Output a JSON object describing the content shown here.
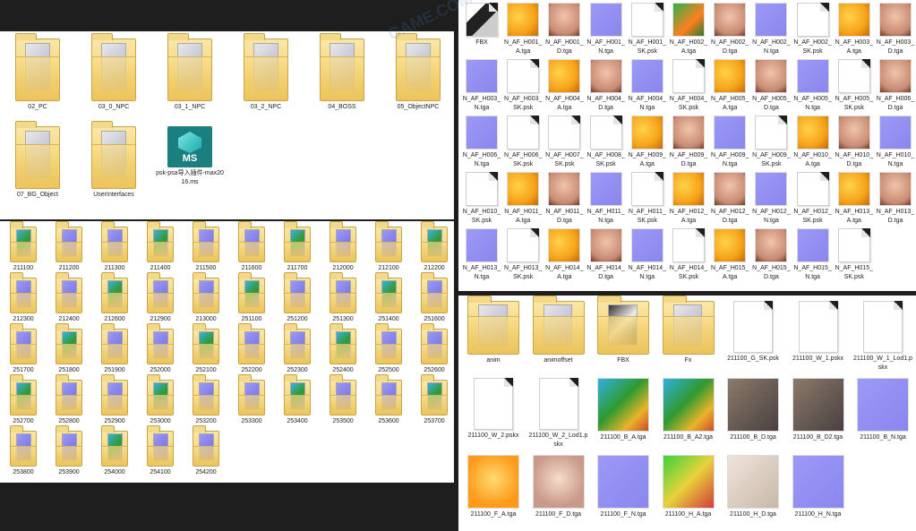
{
  "panels": {
    "top_left": {
      "items": [
        {
          "type": "folder",
          "label": "02_PC"
        },
        {
          "type": "folder",
          "label": "03_0_NPC"
        },
        {
          "type": "folder",
          "label": "03_1_NPC"
        },
        {
          "type": "folder",
          "label": "03_2_NPC"
        },
        {
          "type": "folder",
          "label": "04_BOSS"
        },
        {
          "type": "folder",
          "label": "05_ObjectNPC"
        },
        {
          "type": "folder",
          "label": "07_BG_Object"
        },
        {
          "type": "folder",
          "label": "UserInterfaces"
        },
        {
          "type": "ms",
          "label": "psk-psa导入插件-max2016.ms",
          "icon_text": "MS"
        }
      ]
    },
    "left_bottom": {
      "items": [
        "211100",
        "211200",
        "211300",
        "211400",
        "211500",
        "211600",
        "211700",
        "212000",
        "212100",
        "212200",
        "212300",
        "212400",
        "212600",
        "212900",
        "213000",
        "251100",
        "251200",
        "251300",
        "251400",
        "251600",
        "251700",
        "251800",
        "251900",
        "252000",
        "252100",
        "252200",
        "252300",
        "252400",
        "252500",
        "252600",
        "252700",
        "252800",
        "252900",
        "253000",
        "253200",
        "253300",
        "253400",
        "253500",
        "253600",
        "253700",
        "253800",
        "253900",
        "254000",
        "254100",
        "254200"
      ]
    },
    "top_right": {
      "items": [
        {
          "type": "fbx",
          "label": "FBX"
        },
        {
          "type": "orange",
          "label": "N_AF_H001_A.tga"
        },
        {
          "type": "skin",
          "label": "N_AF_H001_D.tga"
        },
        {
          "type": "normal",
          "label": "N_AF_H001_N.tga"
        },
        {
          "type": "file",
          "label": "N_AF_H001_SK.psk"
        },
        {
          "type": "green",
          "label": "N_AF_H002_A.tga"
        },
        {
          "type": "skin",
          "label": "N_AF_H002_D.tga"
        },
        {
          "type": "normal",
          "label": "N_AF_H002_N.tga"
        },
        {
          "type": "file",
          "label": "N_AF_H002_SK.psk"
        },
        {
          "type": "orange",
          "label": "N_AF_H003_A.tga"
        },
        {
          "type": "skin",
          "label": "N_AF_H003_D.tga"
        },
        {
          "type": "normal",
          "label": "N_AF_H003_N.tga"
        },
        {
          "type": "file",
          "label": "N_AF_H003_SK.psk"
        },
        {
          "type": "orange",
          "label": "N_AF_H004_A.tga"
        },
        {
          "type": "skin",
          "label": "N_AF_H004_D.tga"
        },
        {
          "type": "normal",
          "label": "N_AF_H004_N.tga"
        },
        {
          "type": "file",
          "label": "N_AF_H004_SK.psk"
        },
        {
          "type": "orange",
          "label": "N_AF_H005_A.tga"
        },
        {
          "type": "skin",
          "label": "N_AF_H005_D.tga"
        },
        {
          "type": "normal",
          "label": "N_AF_H005_N.tga"
        },
        {
          "type": "file",
          "label": "N_AF_H005_SK.psk"
        },
        {
          "type": "skin",
          "label": "N_AF_H006_D.tga"
        },
        {
          "type": "normal",
          "label": "N_AF_H006_N.tga"
        },
        {
          "type": "file",
          "label": "N_AF_H006_SK.psk"
        },
        {
          "type": "file",
          "label": "N_AF_H007_SK.psk"
        },
        {
          "type": "file",
          "label": "N_AF_H008_SK.psk"
        },
        {
          "type": "orange",
          "label": "N_AF_H009_A.tga"
        },
        {
          "type": "skin",
          "label": "N_AF_H009_D.tga"
        },
        {
          "type": "normal",
          "label": "N_AF_H009_N.tga"
        },
        {
          "type": "file",
          "label": "N_AF_H009_SK.psk"
        },
        {
          "type": "orange",
          "label": "N_AF_H010_A.tga"
        },
        {
          "type": "skin",
          "label": "N_AF_H010_D.tga"
        },
        {
          "type": "normal",
          "label": "N_AF_H010_N.tga"
        },
        {
          "type": "file",
          "label": "N_AF_H010_SK.psk"
        },
        {
          "type": "orange",
          "label": "N_AF_H011_A.tga"
        },
        {
          "type": "skin",
          "label": "N_AF_H011_D.tga"
        },
        {
          "type": "normal",
          "label": "N_AF_H011_N.tga"
        },
        {
          "type": "file",
          "label": "N_AF_H011_SK.psk"
        },
        {
          "type": "orange",
          "label": "N_AF_H012_A.tga"
        },
        {
          "type": "skin",
          "label": "N_AF_H012_D.tga"
        },
        {
          "type": "normal",
          "label": "N_AF_H012_N.tga"
        },
        {
          "type": "file",
          "label": "N_AF_H012_SK.psk"
        },
        {
          "type": "orange",
          "label": "N_AF_H013_A.tga"
        },
        {
          "type": "skin",
          "label": "N_AF_H013_D.tga"
        },
        {
          "type": "normal",
          "label": "N_AF_H013_N.tga"
        },
        {
          "type": "file",
          "label": "N_AF_H013_SK.psk"
        },
        {
          "type": "orange",
          "label": "N_AF_H014_A.tga"
        },
        {
          "type": "skin",
          "label": "N_AF_H014_D.tga"
        },
        {
          "type": "normal",
          "label": "N_AF_H014_N.tga"
        },
        {
          "type": "file",
          "label": "N_AF_H014_SK.psk"
        },
        {
          "type": "orange",
          "label": "N_AF_H015_A.tga"
        },
        {
          "type": "skin",
          "label": "N_AF_H015_D.tga"
        },
        {
          "type": "normal",
          "label": "N_AF_H015_N.tga"
        },
        {
          "type": "file",
          "label": "N_AF_H015_SK.psk"
        }
      ]
    },
    "bottom_right": {
      "items": [
        {
          "type": "folder",
          "label": "anim"
        },
        {
          "type": "folder",
          "label": "animoffset"
        },
        {
          "type": "fbxfolder",
          "label": "FBX"
        },
        {
          "type": "folder",
          "label": "Fx"
        },
        {
          "type": "file",
          "label": "211100_G_SK.psk"
        },
        {
          "type": "file",
          "label": "211100_W_1.pskx"
        },
        {
          "type": "file",
          "label": "211100_W_1_Lod1.pskx"
        },
        {
          "type": "file",
          "label": "211100_W_2.pskx"
        },
        {
          "type": "file",
          "label": "211100_W_2_Lod1.pskx"
        },
        {
          "type": "mixed",
          "label": "211100_B_A.tga"
        },
        {
          "type": "mixed",
          "label": "211100_B_A2.tga"
        },
        {
          "type": "dark",
          "label": "211100_B_D.tga"
        },
        {
          "type": "dark",
          "label": "211100_B_D2.tga"
        },
        {
          "type": "normal",
          "label": "211100_B_N.tga"
        },
        {
          "type": "orangeface",
          "label": "211100_F_A.tga"
        },
        {
          "type": "face",
          "label": "211100_F_D.tga"
        },
        {
          "type": "normal",
          "label": "211100_F_N.tga"
        },
        {
          "type": "greenred",
          "label": "211100_H_A.tga"
        },
        {
          "type": "beige",
          "label": "211100_H_D.tga"
        },
        {
          "type": "normal",
          "label": "211100_H_N.tga"
        }
      ]
    }
  },
  "colors": {
    "normal": "#8a86ee",
    "orange": "#f5a31a",
    "skin": "#c98a72",
    "green": "#2bb24a",
    "dark": "#4a4040",
    "accent": "#1b7f7f"
  },
  "watermark": "GAME.COM"
}
